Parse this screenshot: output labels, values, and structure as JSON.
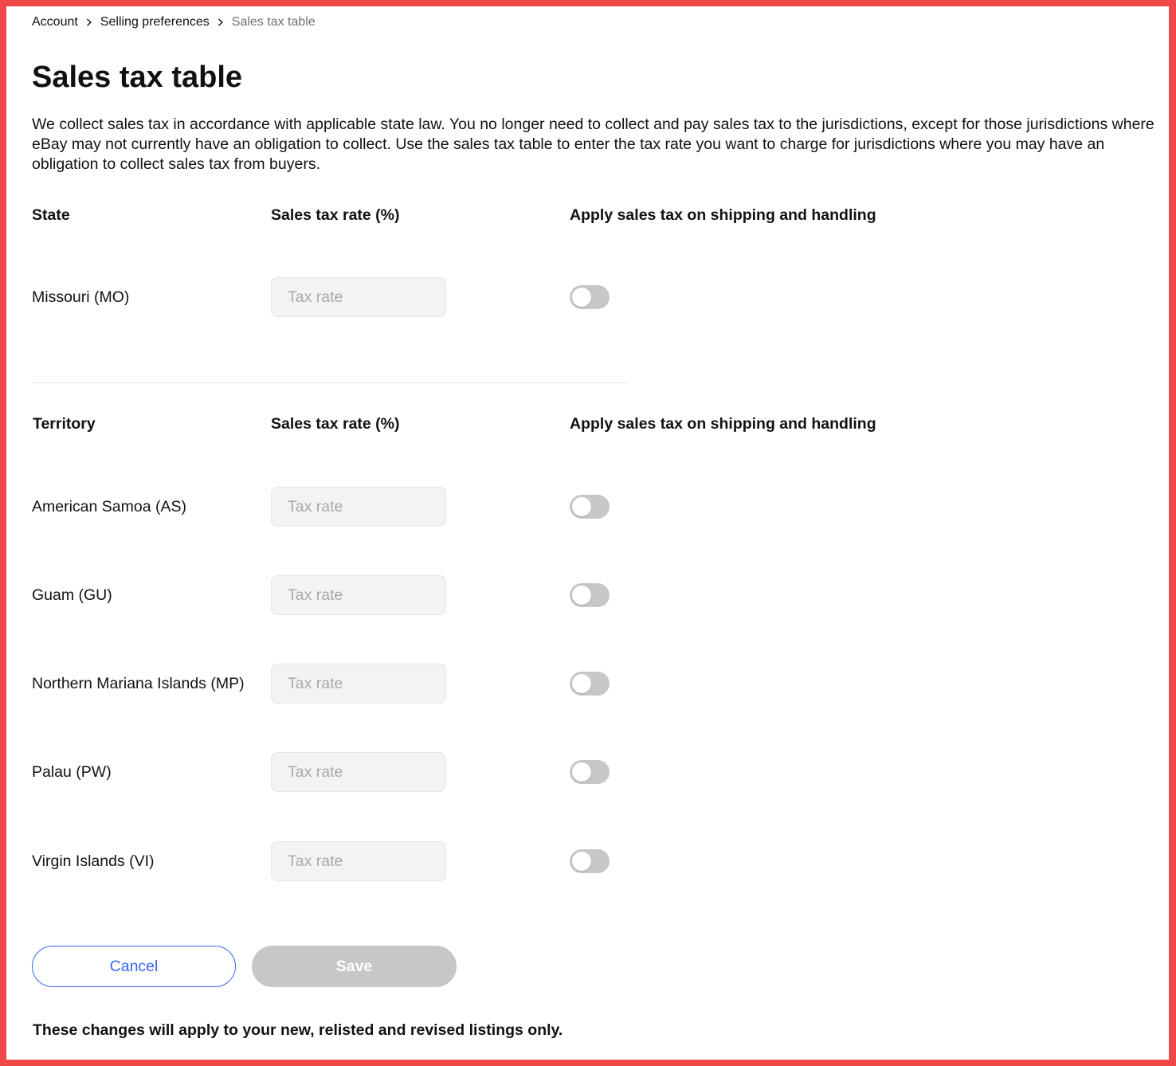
{
  "breadcrumb": {
    "items": [
      "Account",
      "Selling preferences"
    ],
    "current": "Sales tax table"
  },
  "page": {
    "title": "Sales tax table",
    "intro": "We collect sales tax in accordance with applicable state law. You no longer need to collect and pay sales tax to the jurisdictions, except for those jurisdictions where eBay may not currently have an obligation to collect. Use the sales tax table to enter the tax rate you want to charge for jurisdictions where you may have an obligation to collect sales tax from buyers."
  },
  "state_section": {
    "headers": {
      "region": "State",
      "rate": "Sales tax rate (%)",
      "apply": "Apply sales tax on shipping and handling"
    },
    "rows": [
      {
        "label": "Missouri (MO)",
        "placeholder": "Tax rate",
        "value": "",
        "apply_on": false
      }
    ]
  },
  "territory_section": {
    "headers": {
      "region": "Territory",
      "rate": "Sales tax rate (%)",
      "apply": "Apply sales tax on shipping and handling"
    },
    "rows": [
      {
        "label": "American Samoa (AS)",
        "placeholder": "Tax rate",
        "value": "",
        "apply_on": false
      },
      {
        "label": "Guam (GU)",
        "placeholder": "Tax rate",
        "value": "",
        "apply_on": false
      },
      {
        "label": "Northern Mariana Islands (MP)",
        "placeholder": "Tax rate",
        "value": "",
        "apply_on": false
      },
      {
        "label": "Palau (PW)",
        "placeholder": "Tax rate",
        "value": "",
        "apply_on": false
      },
      {
        "label": "Virgin Islands (VI)",
        "placeholder": "Tax rate",
        "value": "",
        "apply_on": false
      }
    ]
  },
  "actions": {
    "cancel_label": "Cancel",
    "save_label": "Save",
    "save_enabled": false
  },
  "footnote": "These changes will apply to your new, relisted and revised listings only.",
  "icons": {
    "breadcrumb_separator": "chevron-right-icon"
  },
  "colors": {
    "accent": "#3665f3",
    "disabled": "#c7c7c7",
    "input_bg": "#f3f3f3",
    "frame": "#f04848"
  }
}
